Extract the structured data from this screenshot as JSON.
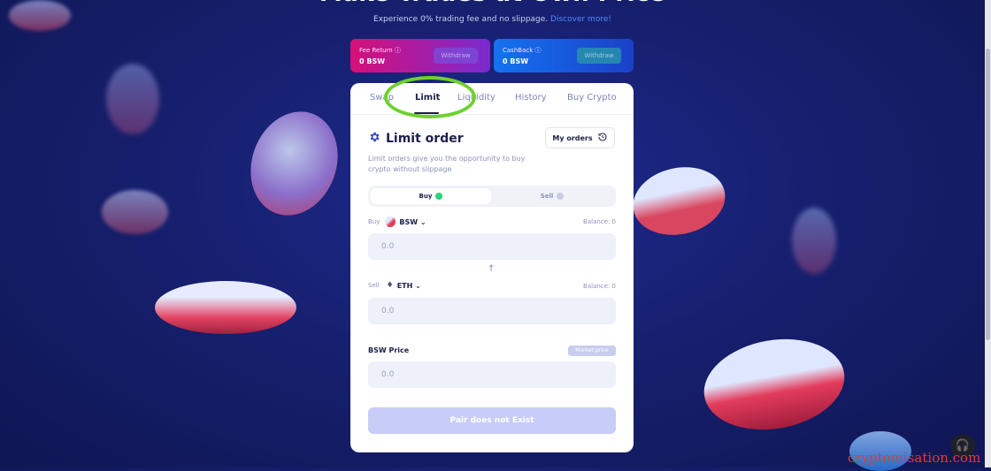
{
  "hero": {
    "headline": "Make Trades at Own Price",
    "subline": "Experience 0% trading fee and no slippage.",
    "link": "Discover more!"
  },
  "rewards": {
    "fee_return": {
      "label": "Fee Return ⓘ",
      "value": "0 BSW",
      "button": "Withdraw"
    },
    "cashback": {
      "label": "CashBack ⓘ",
      "value": "0 BSW",
      "button": "Withdraw"
    }
  },
  "tabs": [
    "Swap",
    "Limit",
    "Liquidity",
    "History",
    "Buy Crypto"
  ],
  "active_tab": "Limit",
  "limit": {
    "title": "Limit order",
    "my_orders": "My orders",
    "description": "Limit orders give you the opportunity to buy crypto without slippage",
    "toggle": {
      "buy": "Buy",
      "sell": "Sell"
    },
    "buy": {
      "label": "Buy",
      "token": "BSW",
      "balance": "Balance: 0",
      "placeholder": "0.0"
    },
    "sell": {
      "label": "Sell",
      "token": "ETH",
      "balance": "Balance: 0",
      "placeholder": "0.0"
    },
    "price": {
      "label": "BSW Price",
      "market_button": "Market price",
      "placeholder": "0.0"
    },
    "submit": "Pair does not Exist"
  },
  "watermark": "cryptomisation.com",
  "colors": {
    "accent": "#1b2149",
    "buy_dot": "#2ad47a",
    "highlight": "#6ed12c",
    "background": "#17206f"
  },
  "icons": {
    "settings": "gear-icon",
    "history": "history-clock-icon",
    "support": "headset-icon",
    "arrow": "arrow-up-icon"
  }
}
